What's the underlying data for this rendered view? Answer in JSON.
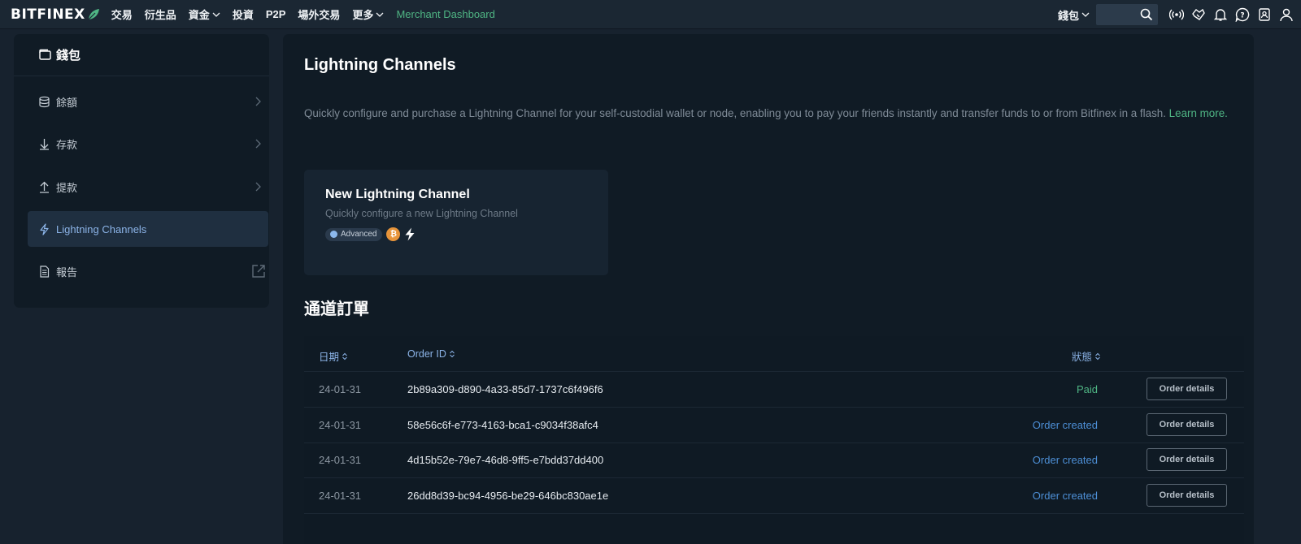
{
  "app": {
    "logo_text": "BITFINEX",
    "accent_color": "#4fb584",
    "link_color": "#8cb4e8"
  },
  "nav": {
    "items": [
      {
        "label": "交易",
        "dropdown": false
      },
      {
        "label": "衍生品",
        "dropdown": false
      },
      {
        "label": "資金",
        "dropdown": true
      },
      {
        "label": "投資",
        "dropdown": false
      },
      {
        "label": "P2P",
        "dropdown": false
      },
      {
        "label": "場外交易",
        "dropdown": false
      },
      {
        "label": "更多",
        "dropdown": true
      }
    ],
    "merchant": "Merchant Dashboard"
  },
  "topright": {
    "wallet_label": "錢包",
    "search_placeholder": "",
    "icons": [
      "broadcast-icon",
      "handshake-icon",
      "bell-icon",
      "help-icon",
      "user-card-icon",
      "account-icon"
    ]
  },
  "sidebar": {
    "title": "錢包",
    "items": [
      {
        "label": "餘額",
        "icon": "coins-icon",
        "active": false
      },
      {
        "label": "存款",
        "icon": "download-icon",
        "active": false
      },
      {
        "label": "提款",
        "icon": "upload-icon",
        "active": false
      },
      {
        "label": "Lightning Channels",
        "icon": "lightning-icon",
        "active": true
      },
      {
        "label": "報告",
        "icon": "document-icon",
        "active": false,
        "external": true
      }
    ]
  },
  "main": {
    "title": "Lightning Channels",
    "intro": "Quickly configure and purchase a Lightning Channel for your self-custodial wallet or node, enabling you to pay your friends instantly and transfer funds to or from Bitfinex in a flash. ",
    "learn_more": "Learn more.",
    "card": {
      "title": "New Lightning Channel",
      "subtitle": "Quickly configure a new Lightning Channel",
      "badge": "Advanced",
      "btc_symbol": "₿"
    },
    "orders_title": "通道訂單",
    "table": {
      "headers": {
        "date": "日期",
        "order_id": "Order ID",
        "status": "狀態"
      },
      "button_label": "Order details",
      "rows": [
        {
          "date": "24-01-31",
          "order_id": "2b89a309-d890-4a33-85d7-1737c6f496f6",
          "status": "Paid",
          "status_type": "paid"
        },
        {
          "date": "24-01-31",
          "order_id": "58e56c6f-e773-4163-bca1-c9034f38afc4",
          "status": "Order created",
          "status_type": "created"
        },
        {
          "date": "24-01-31",
          "order_id": "4d15b52e-79e7-46d8-9ff5-e7bdd37dd400",
          "status": "Order created",
          "status_type": "created"
        },
        {
          "date": "24-01-31",
          "order_id": "26dd8d39-bc94-4956-be29-646bc830ae1e",
          "status": "Order created",
          "status_type": "created"
        }
      ]
    }
  }
}
